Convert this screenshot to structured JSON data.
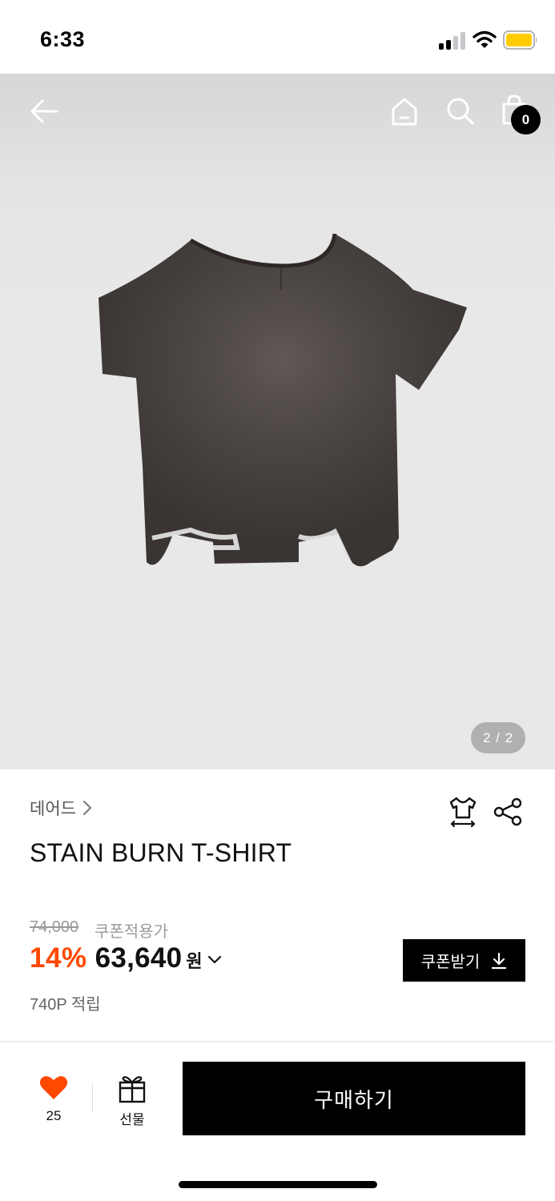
{
  "status_bar": {
    "time": "6:33"
  },
  "header": {
    "cart_count": "0"
  },
  "gallery": {
    "counter": "2 / 2"
  },
  "product": {
    "brand": "데어드",
    "title": "STAIN BURN T-SHIRT"
  },
  "pricing": {
    "original_price": "74,000",
    "coupon_note": "쿠폰적용가",
    "discount": "14%",
    "price": "63,640",
    "currency": "원",
    "coupon_button": "쿠폰받기",
    "points": "740P 적립"
  },
  "bottom_bar": {
    "like_count": "25",
    "gift_label": "선물",
    "buy_label": "구매하기"
  },
  "colors": {
    "accent": "#ff4800",
    "button_bg": "#000000",
    "hero_bg": "#e8e8e8"
  },
  "icons": [
    "back-arrow-icon",
    "home-icon",
    "search-icon",
    "shopping-bag-icon",
    "size-guide-icon",
    "share-icon",
    "chevron-right-icon",
    "chevron-down-icon",
    "download-icon",
    "heart-icon",
    "gift-icon"
  ]
}
